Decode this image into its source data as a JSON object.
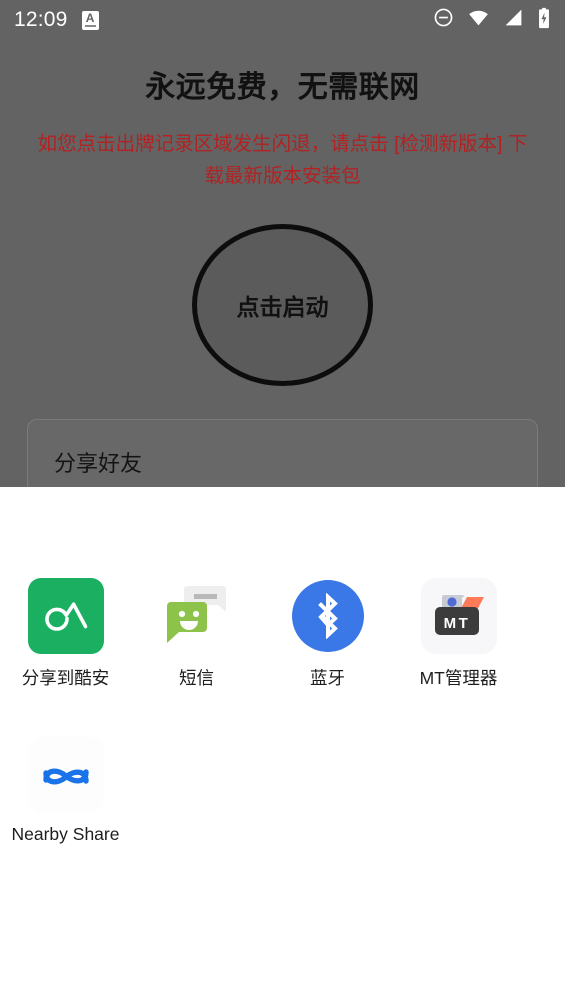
{
  "status_bar": {
    "clock": "12:09",
    "badge_letter": "A",
    "icons": [
      "dnd-icon",
      "wifi-icon",
      "signal-icon",
      "battery-charging-icon"
    ]
  },
  "app": {
    "title": "永远免费，无需联网",
    "warning": "如您点击出牌记录区域发生闪退，请点击 [检测新版本] 下载最新版本安装包",
    "warning_color": "#b22222",
    "start_button_label": "点击启动",
    "share_card_title": "分享好友"
  },
  "share_sheet": {
    "targets": [
      {
        "label": "分享到酷安",
        "icon": "coolapk-icon",
        "color": "#1BAF62"
      },
      {
        "label": "短信",
        "icon": "sms-icon",
        "color": "#8BC34A"
      },
      {
        "label": "蓝牙",
        "icon": "bluetooth-icon",
        "color": "#3B78E7"
      },
      {
        "label": "MT管理器",
        "icon": "mt-manager-icon",
        "color": "#3C3C3C"
      },
      {
        "label": "Nearby Share",
        "icon": "nearby-share-icon",
        "color": "#1A73E8"
      }
    ]
  }
}
